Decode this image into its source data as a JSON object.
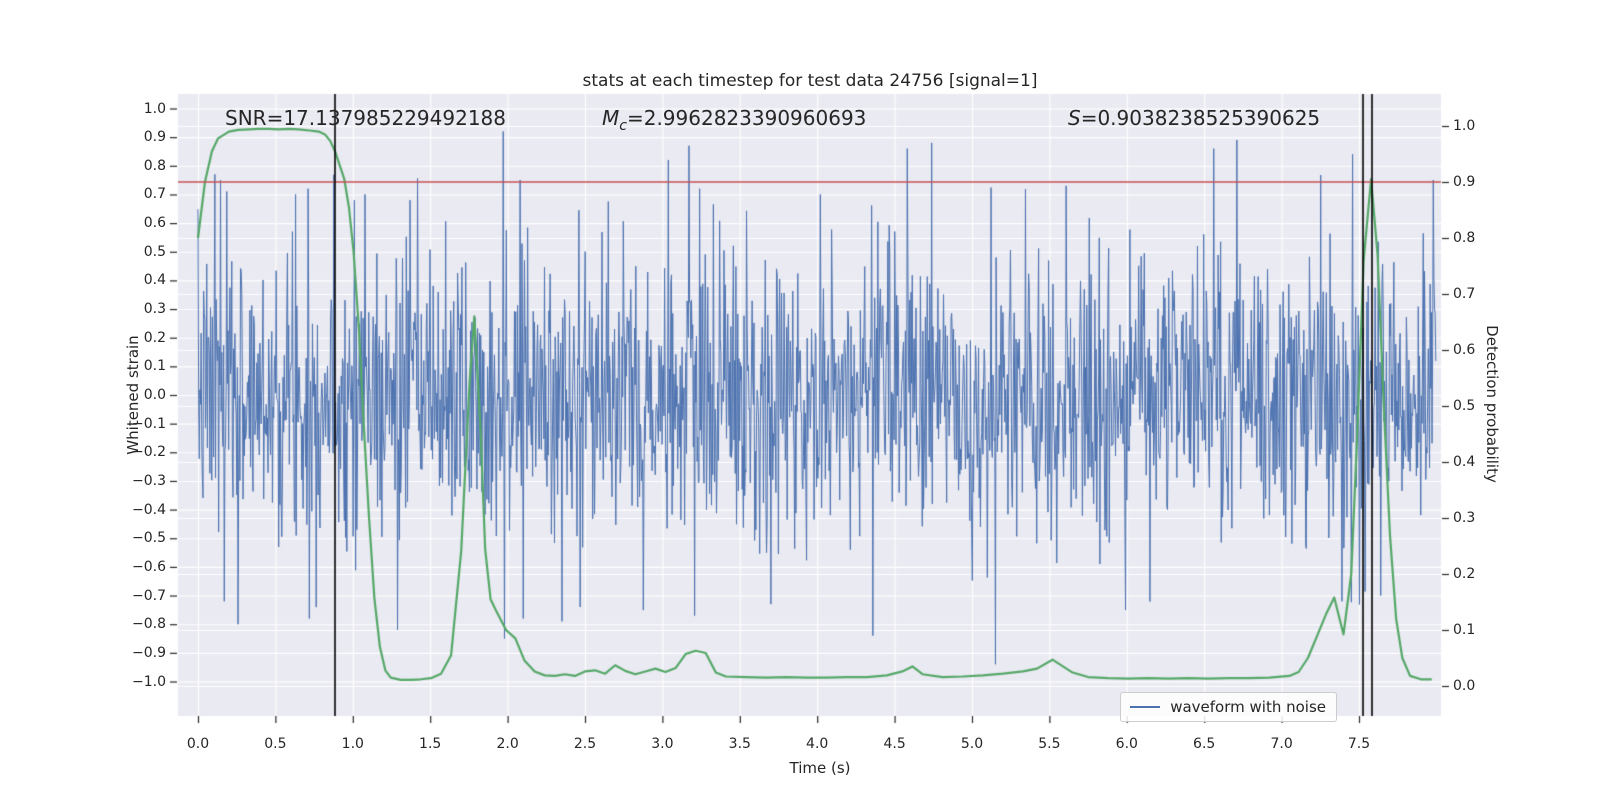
{
  "chart_data": {
    "type": "line",
    "title": "stats at each timestep for test data 24756 [signal=1]",
    "xlabel": "Time (s)",
    "ylabel_left": "Whitened strain",
    "ylabel_right": "Detection probability",
    "xlim": [
      -0.13,
      8.03
    ],
    "ylim_left": [
      -1.17,
      1.05
    ],
    "ylim_right": [
      -0.054,
      1.057
    ],
    "grid": true,
    "background_color": "#eaeaf2",
    "grid_color": "#ffffff",
    "x_ticks": [
      0.0,
      0.5,
      1.0,
      1.5,
      2.0,
      2.5,
      3.0,
      3.5,
      4.0,
      4.5,
      5.0,
      5.5,
      6.0,
      6.5,
      7.0,
      7.5
    ],
    "x_tick_labels": [
      "0.0",
      "0.5",
      "1.0",
      "1.5",
      "2.0",
      "2.5",
      "3.0",
      "3.5",
      "4.0",
      "4.5",
      "5.0",
      "5.5",
      "6.0",
      "6.5",
      "7.0",
      "7.5"
    ],
    "left_ticks": [
      1.0,
      0.9,
      0.8,
      0.7,
      0.6,
      0.5,
      0.4,
      0.3,
      0.2,
      0.1,
      0.0,
      -0.1,
      -0.2,
      -0.3,
      -0.4,
      -0.5,
      -0.6,
      -0.7,
      -0.8,
      -0.9,
      -1.0
    ],
    "left_tick_labels": [
      "1.0",
      "0.9",
      "0.8",
      "0.7",
      "0.6",
      "0.5",
      "0.4",
      "0.3",
      "0.2",
      "0.1",
      "0.0",
      "−0.1",
      "−0.2",
      "−0.3",
      "−0.4",
      "−0.5",
      "−0.6",
      "−0.7",
      "−0.8",
      "−0.9",
      "−1.0"
    ],
    "right_ticks": [
      1.0,
      0.9,
      0.8,
      0.7,
      0.6,
      0.5,
      0.4,
      0.3,
      0.2,
      0.1,
      0.0
    ],
    "right_tick_labels": [
      "1.0",
      "0.9",
      "0.8",
      "0.7",
      "0.6",
      "0.5",
      "0.4",
      "0.3",
      "0.2",
      "0.1",
      "0.0"
    ],
    "annotations": [
      {
        "id": "snr",
        "prefix": "SNR",
        "sub": "",
        "value": "=17.137985229492188"
      },
      {
        "id": "mc",
        "prefix": "M",
        "sub": "c",
        "value": "=2.9962823390960693"
      },
      {
        "id": "s",
        "prefix": "S",
        "sub": "",
        "value": "=0.9038238525390625"
      }
    ],
    "threshold": {
      "axis": "right",
      "value": 0.9,
      "color": "#c44e52"
    },
    "event_vlines": {
      "color": "#000000",
      "times": [
        0.885,
        7.526,
        7.584
      ]
    },
    "series": [
      {
        "name": "waveform with noise",
        "type": "noise",
        "axis": "left",
        "color": "#4c72b0",
        "t_start": 0.0,
        "t_end": 8.0,
        "n": 1980,
        "sigma": 0.235,
        "clip": 0.82,
        "seed": 7,
        "notable_spikes": [
          [
            0.11,
            0.77
          ],
          [
            0.145,
            0.75
          ],
          [
            0.17,
            -0.72
          ],
          [
            0.26,
            -0.8
          ],
          [
            0.63,
            0.7
          ],
          [
            0.71,
            0.72
          ],
          [
            0.72,
            -0.78
          ],
          [
            1.01,
            0.68
          ],
          [
            1.08,
            0.7
          ],
          [
            1.29,
            -0.82
          ],
          [
            1.37,
            0.68
          ],
          [
            1.97,
            0.92
          ],
          [
            1.98,
            -0.85
          ],
          [
            2.08,
            0.75
          ],
          [
            2.1,
            -0.78
          ],
          [
            2.35,
            -0.79
          ],
          [
            2.47,
            -0.74
          ],
          [
            3.04,
            0.82
          ],
          [
            3.17,
            0.87
          ],
          [
            3.21,
            -0.77
          ],
          [
            3.24,
            0.72
          ],
          [
            3.7,
            -0.73
          ],
          [
            4.02,
            0.7
          ],
          [
            4.36,
            -0.84
          ],
          [
            4.58,
            0.86
          ],
          [
            4.74,
            0.88
          ],
          [
            5.15,
            -0.94
          ],
          [
            5.61,
            0.73
          ],
          [
            5.99,
            -0.75
          ],
          [
            6.56,
            0.86
          ],
          [
            6.71,
            0.89
          ],
          [
            7.39,
            -0.72
          ],
          [
            7.46,
            0.84
          ],
          [
            7.64,
            -0.7
          ],
          [
            7.98,
            0.75
          ]
        ]
      },
      {
        "name": "detection probability",
        "type": "curve",
        "axis": "right",
        "color": "#55a868",
        "points": [
          [
            0.0,
            0.8
          ],
          [
            0.045,
            0.9
          ],
          [
            0.09,
            0.955
          ],
          [
            0.13,
            0.978
          ],
          [
            0.2,
            0.99
          ],
          [
            0.26,
            0.993
          ],
          [
            0.33,
            0.994
          ],
          [
            0.39,
            0.995
          ],
          [
            0.46,
            0.995
          ],
          [
            0.52,
            0.994
          ],
          [
            0.59,
            0.995
          ],
          [
            0.65,
            0.994
          ],
          [
            0.72,
            0.992
          ],
          [
            0.78,
            0.99
          ],
          [
            0.82,
            0.985
          ],
          [
            0.855,
            0.973
          ],
          [
            0.885,
            0.955
          ],
          [
            0.915,
            0.93
          ],
          [
            0.945,
            0.905
          ],
          [
            0.975,
            0.855
          ],
          [
            1.005,
            0.775
          ],
          [
            1.04,
            0.635
          ],
          [
            1.07,
            0.47
          ],
          [
            1.105,
            0.3
          ],
          [
            1.14,
            0.155
          ],
          [
            1.175,
            0.07
          ],
          [
            1.21,
            0.028
          ],
          [
            1.245,
            0.015
          ],
          [
            1.31,
            0.011
          ],
          [
            1.375,
            0.011
          ],
          [
            1.44,
            0.012
          ],
          [
            1.505,
            0.014
          ],
          [
            1.57,
            0.022
          ],
          [
            1.635,
            0.055
          ],
          [
            1.7,
            0.24
          ],
          [
            1.755,
            0.545
          ],
          [
            1.785,
            0.66
          ],
          [
            1.825,
            0.46
          ],
          [
            1.855,
            0.245
          ],
          [
            1.89,
            0.155
          ],
          [
            1.925,
            0.135
          ],
          [
            1.99,
            0.1
          ],
          [
            2.05,
            0.085
          ],
          [
            2.11,
            0.045
          ],
          [
            2.175,
            0.026
          ],
          [
            2.24,
            0.019
          ],
          [
            2.305,
            0.018
          ],
          [
            2.37,
            0.021
          ],
          [
            2.435,
            0.018
          ],
          [
            2.5,
            0.026
          ],
          [
            2.565,
            0.028
          ],
          [
            2.63,
            0.022
          ],
          [
            2.695,
            0.037
          ],
          [
            2.76,
            0.027
          ],
          [
            2.825,
            0.021
          ],
          [
            2.89,
            0.026
          ],
          [
            2.955,
            0.031
          ],
          [
            3.02,
            0.025
          ],
          [
            3.085,
            0.032
          ],
          [
            3.15,
            0.057
          ],
          [
            3.215,
            0.063
          ],
          [
            3.28,
            0.059
          ],
          [
            3.345,
            0.024
          ],
          [
            3.41,
            0.017
          ],
          [
            3.54,
            0.016
          ],
          [
            3.67,
            0.015
          ],
          [
            3.8,
            0.016
          ],
          [
            3.93,
            0.015
          ],
          [
            4.06,
            0.015
          ],
          [
            4.19,
            0.016
          ],
          [
            4.32,
            0.016
          ],
          [
            4.45,
            0.019
          ],
          [
            4.55,
            0.026
          ],
          [
            4.615,
            0.035
          ],
          [
            4.68,
            0.021
          ],
          [
            4.81,
            0.016
          ],
          [
            4.94,
            0.017
          ],
          [
            5.07,
            0.019
          ],
          [
            5.2,
            0.022
          ],
          [
            5.33,
            0.026
          ],
          [
            5.42,
            0.031
          ],
          [
            5.52,
            0.047
          ],
          [
            5.65,
            0.024
          ],
          [
            5.75,
            0.016
          ],
          [
            5.88,
            0.014
          ],
          [
            6.01,
            0.013
          ],
          [
            6.14,
            0.014
          ],
          [
            6.27,
            0.013
          ],
          [
            6.4,
            0.014
          ],
          [
            6.53,
            0.013
          ],
          [
            6.66,
            0.014
          ],
          [
            6.79,
            0.014
          ],
          [
            6.92,
            0.015
          ],
          [
            7.05,
            0.018
          ],
          [
            7.11,
            0.025
          ],
          [
            7.17,
            0.05
          ],
          [
            7.23,
            0.09
          ],
          [
            7.29,
            0.13
          ],
          [
            7.34,
            0.158
          ],
          [
            7.4,
            0.092
          ],
          [
            7.45,
            0.2
          ],
          [
            7.49,
            0.46
          ],
          [
            7.53,
            0.76
          ],
          [
            7.578,
            0.905
          ],
          [
            7.62,
            0.77
          ],
          [
            7.66,
            0.5
          ],
          [
            7.7,
            0.27
          ],
          [
            7.74,
            0.12
          ],
          [
            7.78,
            0.05
          ],
          [
            7.83,
            0.018
          ],
          [
            7.9,
            0.012
          ],
          [
            7.97,
            0.012
          ]
        ]
      }
    ],
    "legend": {
      "position": "lower right",
      "entries": [
        {
          "label": "waveform with noise",
          "color": "#4c72b0"
        }
      ]
    }
  }
}
